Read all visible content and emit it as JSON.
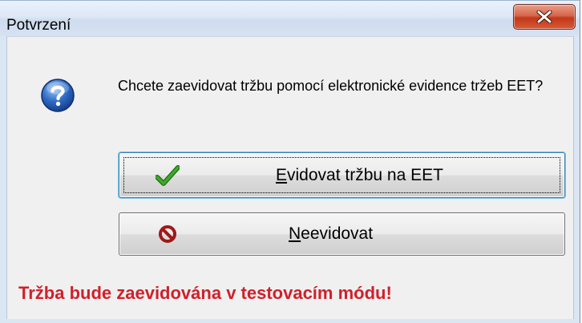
{
  "window": {
    "title": "Potvrzení",
    "close_icon": "close-icon"
  },
  "dialog": {
    "icon": "question-icon",
    "message": "Chcete zaevidovat tržbu pomocí elektronické evidence tržeb EET?",
    "buttons": [
      {
        "icon": "checkmark-icon",
        "label_mnemonic": "E",
        "label_rest": "vidovat tržbu na EET",
        "focused": true
      },
      {
        "icon": "prohibited-icon",
        "label_mnemonic": "N",
        "label_rest": "eevidovat",
        "focused": false
      }
    ],
    "warning": "Tržba bude zaevidována v testovacím módu!"
  },
  "colors": {
    "warning_text": "#d0202a",
    "close_button": "#c2381a",
    "checkmark": "#2e8b1e",
    "prohibited": "#a01818"
  }
}
